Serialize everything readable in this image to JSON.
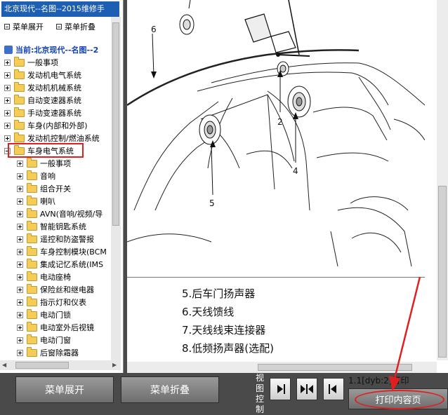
{
  "window_title": "北京现代--名图--2015维修手",
  "left_toolbar": {
    "expand_label": "菜单展开",
    "collapse_label": "菜单折叠"
  },
  "tree": {
    "root_label": "当前:北京现代--名图--2",
    "top_items": [
      "一般事项",
      "发动机电气系统",
      "发动机机械系统",
      "自动变速器系统",
      "手动变速器系统",
      "车身(内部和外部)",
      "发动机控制/燃油系统",
      "车身电气系统"
    ],
    "selected_item": "车身电气系统",
    "sub_items": [
      "一般事项",
      "音响",
      "组合开关",
      "喇叭",
      "AVN(音响/视频/导",
      "智能钥匙系统",
      "遥控和防盗警报",
      "车身控制模块(BCM",
      "集成记忆系统(IMS",
      "电动座椅",
      "保险丝和继电器",
      "指示灯和仪表",
      "电动门锁",
      "电动室外后视镜",
      "电动门窗",
      "后窗除霜器"
    ]
  },
  "diagram": {
    "callouts": [
      "6",
      "2",
      "4",
      "5"
    ],
    "captions": [
      "5.后车门扬声器",
      "6.天线馈线",
      "7.天线线束连接器",
      "8.低频扬声器(选配)"
    ]
  },
  "bottom_bar": {
    "expand_button": "菜单展开",
    "collapse_button": "菜单折叠",
    "view_control_label": "视图控制",
    "status_text": "1.1[dyb:2]打印",
    "print_button": "打印内容页"
  },
  "colors": {
    "title_bar": "#1d5fb3",
    "highlight": "#e02020",
    "root_text": "#1141b8"
  }
}
